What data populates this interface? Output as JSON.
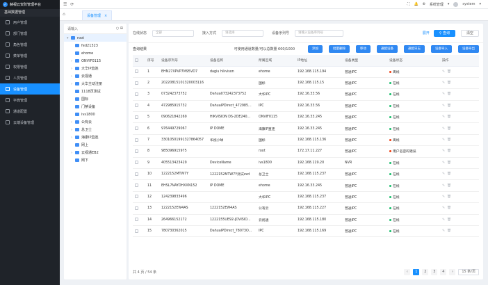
{
  "app_title": "赫视云安防管理平台",
  "section_title": "基础数据管理",
  "menu": [
    {
      "label": "用户管理"
    },
    {
      "label": "部门管理"
    },
    {
      "label": "角色管理"
    },
    {
      "label": "菜单管理"
    },
    {
      "label": "权限管理"
    },
    {
      "label": "人员管理"
    },
    {
      "label": "设备管理",
      "active": true
    },
    {
      "label": "字典管理"
    },
    {
      "label": "通道配置"
    },
    {
      "label": "云端设备管理"
    }
  ],
  "topbar": {
    "system_menu": "系统管理",
    "user": "system"
  },
  "tab": {
    "label": "设备管理"
  },
  "tree": {
    "placeholder": "请输入",
    "nodes": [
      {
        "label": "root",
        "level": 0,
        "arrow": "▾",
        "selected": true
      },
      {
        "label": "fed21323",
        "level": 1,
        "arrow": ""
      },
      {
        "label": "ehome",
        "level": 1,
        "arrow": ""
      },
      {
        "label": "ONVIF0115",
        "level": 1,
        "arrow": "›"
      },
      {
        "label": "大华IP直连",
        "level": 1,
        "arrow": "›"
      },
      {
        "label": "云视通",
        "level": 1,
        "arrow": "›"
      },
      {
        "label": "大华主动注册",
        "level": 1,
        "arrow": "›"
      },
      {
        "label": "1118页测试",
        "level": 1,
        "arrow": ""
      },
      {
        "label": "国标",
        "level": 1,
        "arrow": ""
      },
      {
        "label": "门禁设备",
        "level": 1,
        "arrow": ""
      },
      {
        "label": "ivs1800",
        "level": 1,
        "arrow": ""
      },
      {
        "label": "公有云",
        "level": 1,
        "arrow": "›"
      },
      {
        "label": "总卫士",
        "level": 1,
        "arrow": "›"
      },
      {
        "label": "海康IP直连",
        "level": 1,
        "arrow": "›"
      },
      {
        "label": "网上",
        "level": 1,
        "arrow": ""
      },
      {
        "label": "云视通EB2",
        "level": 1,
        "arrow": "›"
      },
      {
        "label": "网下",
        "level": 1,
        "arrow": ""
      }
    ]
  },
  "filters": {
    "online_label": "在线状态",
    "online_value": "全部",
    "access_label": "接入方式",
    "access_placeholder": "请选择",
    "serial_label": "设备序列号",
    "serial_placeholder": "请输入设备序列号",
    "fold": "展开",
    "query": "查询",
    "reset": "清空"
  },
  "toolbar": {
    "result_label": "查询结果",
    "count_label": "可使用通道数量/可以总数量",
    "count_value": "600/1000",
    "buttons": [
      "添加",
      "批量删除",
      "移动",
      "通配设备",
      "通配日志",
      "设备导入",
      "设备导出"
    ]
  },
  "table": {
    "headers": [
      "序号",
      "设备序列号",
      "设备名称",
      "所属区域",
      "IP地址",
      "设备类型",
      "设备状态",
      "操作"
    ],
    "rows": [
      [
        "1",
        "EHN27XPVP7M95VD7",
        "dagiu hikvison",
        "ehome",
        "192.168.115.194",
        "普通IPC",
        "离线"
      ],
      [
        "2",
        "20220815101320003116",
        "",
        "国标",
        "192.168.115.15",
        "普通IPC",
        "在线"
      ],
      [
        "3",
        "073242373752",
        "Dahua073242373752",
        "大华IPC",
        "192.16.33.56",
        "普通IPC",
        "在线"
      ],
      [
        "4",
        "472985915732",
        "DahuaIPDirect_472985...",
        "IPC",
        "192.16.33.56",
        "普通IPC",
        "在线"
      ],
      [
        "5",
        "090621842269",
        "HIKVISION DS-2DE240...",
        "ONVIF0115",
        "192.16.33.245",
        "普通IPC",
        "在线"
      ],
      [
        "6",
        "976449729067",
        "IP DOME",
        "海康IP直连",
        "192.16.33.245",
        "普通IPC",
        "在线"
      ],
      [
        "7",
        "3301050199132786405​7",
        "华视小球",
        "国标",
        "192.168.115.136",
        "普通IPC",
        "离线"
      ],
      [
        "8",
        "985096915975",
        "",
        "root",
        "172.17.11.227",
        "普通IPC",
        "用户名密码错误"
      ],
      [
        "9",
        "405513423429",
        "DeviceName",
        "ivs1800",
        "192.168.119.20",
        "NVR",
        "在线"
      ],
      [
        "10",
        "1222152MTW7Y",
        "1222152MTW7Y测试zxd",
        "总卫士",
        "192.168.115.237",
        "普通IPC",
        "在线"
      ],
      [
        "11",
        "EHSL7NAYDHXXN152",
        "IP DOME",
        "ehome",
        "192.16.33.245",
        "普通IPC",
        "在线"
      ],
      [
        "12",
        "124239833496",
        "",
        "大华IPC",
        "192.168.115.237",
        "普通IPC",
        "在线"
      ],
      [
        "13",
        "1222152EW4AS",
        "1222152EW4AS",
        "公有云",
        "192.168.115.227",
        "普通IPC",
        "在线"
      ],
      [
        "14",
        "264966152172",
        "1222155UE92-JOVISIO...",
        "云视通",
        "192.168.115.180",
        "普通IPC",
        "在线"
      ],
      [
        "15",
        "780730362015",
        "DahuaIPDirect_78073O...",
        "IPC",
        "192.168.115.169",
        "普通IPC",
        "在线"
      ]
    ]
  },
  "status_colors": {
    "在线": "#19be6b",
    "离线": "#ed4014",
    "用户名密码错误": "#ed4014"
  },
  "pagination": {
    "total": "共 4 页 / 54 条",
    "pages": [
      "1",
      "2",
      "3",
      "4"
    ],
    "current": "1",
    "page_size": "15 条/页"
  }
}
